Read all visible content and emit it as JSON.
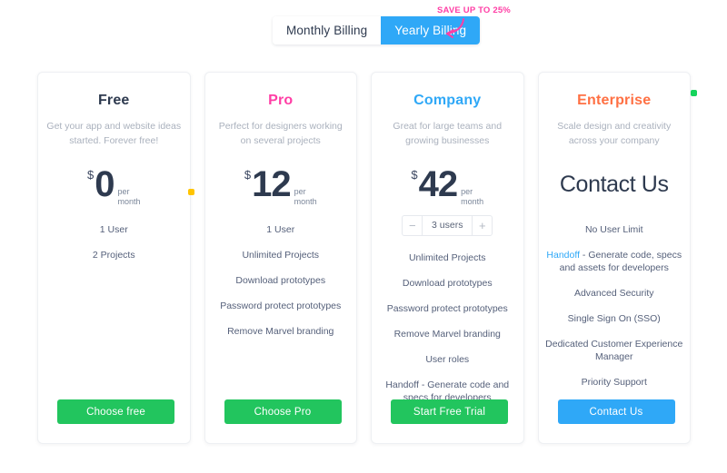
{
  "billing": {
    "options": [
      {
        "label": "Monthly Billing",
        "active": false
      },
      {
        "label": "Yearly Billing",
        "active": true
      }
    ],
    "save_badge": "SAVE UP TO 25%"
  },
  "colors": {
    "free": "#2e3a4f",
    "pro": "#ff3ea5",
    "company": "#2fa8f7",
    "enterprise": "#ff7043",
    "cta_green": "#22c55e",
    "cta_blue": "#2fa8f7",
    "badge_pink": "#ff3ea5",
    "marker_yellow": "#ffc400",
    "marker_green": "#15d45c"
  },
  "plans": [
    {
      "name": "Free",
      "description": "Get your app and website ideas started. Forever free!",
      "currency": "$",
      "amount": "0",
      "per_line_1": "per",
      "per_line_2": "month",
      "features": [
        "1 User",
        "2 Projects"
      ],
      "cta_label": "Choose free"
    },
    {
      "name": "Pro",
      "description": "Perfect for designers working on several projects",
      "currency": "$",
      "amount": "12",
      "per_line_1": "per",
      "per_line_2": "month",
      "features": [
        "1 User",
        "Unlimited Projects",
        "Download prototypes",
        "Password protect prototypes",
        "Remove Marvel branding"
      ],
      "cta_label": "Choose Pro"
    },
    {
      "name": "Company",
      "description": "Great for large teams and growing businesses",
      "currency": "$",
      "amount": "42",
      "per_line_1": "per",
      "per_line_2": "month",
      "stepper": {
        "decrement": "−",
        "value": "3 users",
        "increment": "+"
      },
      "features": [
        "Unlimited Projects",
        "Download prototypes",
        "Password protect prototypes",
        "Remove Marvel branding",
        "User roles",
        "Handoff - Generate code and specs for developers"
      ],
      "cta_label": "Start Free Trial"
    },
    {
      "name": "Enterprise",
      "description": "Scale design and creativity across your company",
      "headline": "Contact Us",
      "features": [
        "No User Limit",
        "Advanced Security",
        "Single Sign On (SSO)",
        "Dedicated Customer Experience Manager",
        "Priority Support"
      ],
      "handoff_link": "Handoff",
      "handoff_rest": " - Generate code, specs and assets for developers",
      "cta_label": "Contact Us"
    }
  ]
}
